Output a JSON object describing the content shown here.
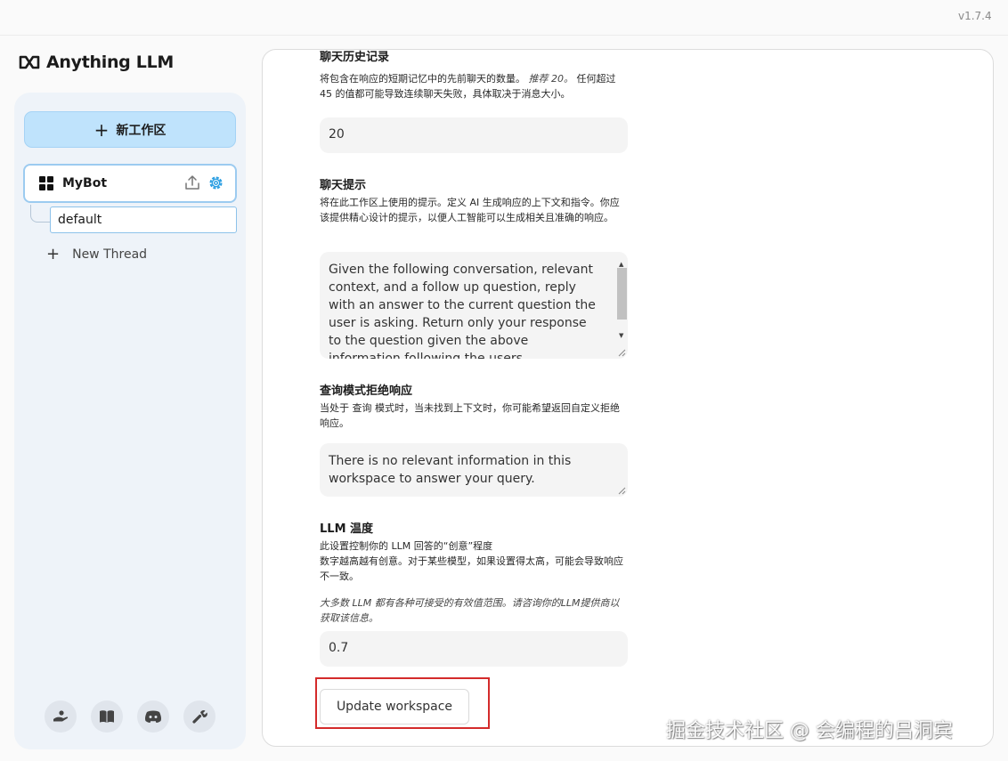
{
  "app": {
    "version": "v1.7.4",
    "logo_text": "Anything LLM"
  },
  "sidebar": {
    "new_workspace_label": "新工作区",
    "workspace": {
      "name": "MyBot",
      "icon": "grid-icon",
      "action_icons": [
        "upload-icon",
        "gear-icon"
      ]
    },
    "threads": [
      {
        "label": "default"
      }
    ],
    "new_thread_label": "New Thread",
    "footer_icons": [
      "community-icon",
      "book-icon",
      "discord-icon",
      "wrench-icon"
    ]
  },
  "settings": {
    "history": {
      "title": "聊天历史记录",
      "desc_prefix": "将包含在响应的短期记忆中的先前聊天的数量。",
      "desc_emphasis": "推荐 20。",
      "desc_suffix": "任何超过 45 的值都可能导致连续聊天失败，具体取决于消息大小。",
      "value": "20"
    },
    "prompt": {
      "title": "聊天提示",
      "description": "将在此工作区上使用的提示。定义 AI 生成响应的上下文和指令。你应该提供精心设计的提示，以便人工智能可以生成相关且准确的响应。",
      "value": "Given the following conversation, relevant context, and a follow up question, reply with an answer to the current question the user is asking. Return only your response to the question given the above information following the users instructions as needed."
    },
    "query_refusal": {
      "title": "查询模式拒绝响应",
      "description": "当处于 查询 模式时，当未找到上下文时，你可能希望返回自定义拒绝响应。",
      "value": "There is no relevant information in this workspace to answer your query."
    },
    "temperature": {
      "title": "LLM 温度",
      "description_line1": "此设置控制你的 LLM 回答的“创意”程度",
      "description_line2": "数字越高越有创意。对于某些模型，如果设置得太高，可能会导致响应不一致。",
      "note": "大多数 LLM 都有各种可接受的有效值范围。请咨询你的LLM提供商以获取该信息。",
      "value": "0.7"
    },
    "update_button": "Update workspace"
  },
  "watermark": "掘金技术社区 @ 会编程的吕洞宾",
  "colors": {
    "accent": "#bfe3fc",
    "gear": "#2a9ee2",
    "highlight": "#d42b2b"
  }
}
